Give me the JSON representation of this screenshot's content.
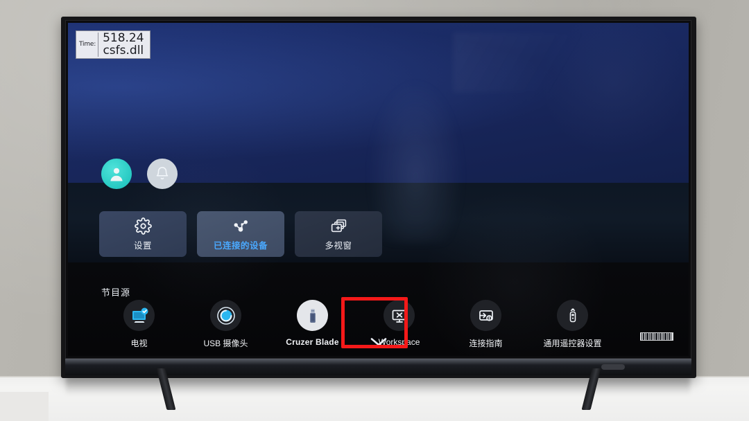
{
  "overlay": {
    "time_label": "Time:",
    "value": "518.24",
    "module": "csfs.dll"
  },
  "account_row": [
    {
      "name": "profile-avatar",
      "icon": "user-avatar-icon"
    },
    {
      "name": "notifications",
      "icon": "bell-icon"
    }
  ],
  "tiles": [
    {
      "label": "设置",
      "icon": "gear-icon",
      "selected": false
    },
    {
      "label": "已连接的设备",
      "icon": "connected-devices-icon",
      "selected": true
    },
    {
      "label": "多视窗",
      "icon": "multi-window-icon",
      "selected": false
    }
  ],
  "sources": {
    "title": "节目源",
    "items": [
      {
        "label": "电视",
        "icon": "tv-monitor-check-icon",
        "highlighted": false
      },
      {
        "label": "USB 摄像头",
        "icon": "camera-lens-icon",
        "highlighted": false
      },
      {
        "label": "Cruzer Blade",
        "icon": "usb-flash-drive-icon",
        "highlighted": true
      },
      {
        "label": "Workspace",
        "icon": "workspace-monitor-icon",
        "highlighted": false
      },
      {
        "label": "连接指南",
        "icon": "connection-guide-icon",
        "highlighted": false
      },
      {
        "label": "通用遥控器设置",
        "icon": "universal-remote-icon",
        "highlighted": false
      }
    ]
  },
  "nav": {
    "scroll_down_icon": "chevron-down-icon"
  },
  "colors": {
    "highlight_box": "#f41919",
    "selected_label": "#4aa9ff",
    "accent_cyan": "#2ec9c2",
    "screen_blue": "#1a2a63"
  }
}
